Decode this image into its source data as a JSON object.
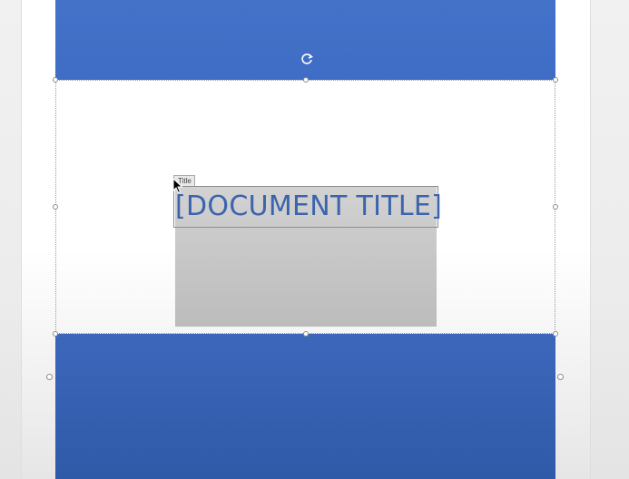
{
  "document": {
    "title_placeholder": "[DOCUMENT TITLE]",
    "control_tag": "Title"
  },
  "colors": {
    "band_blue": "#4472c4",
    "title_text": "#3b64ad",
    "title_box_gray": "#c7c7c7"
  },
  "icons": {
    "rotate": "rotate-handle-icon",
    "cursor": "mouse-pointer-icon"
  }
}
